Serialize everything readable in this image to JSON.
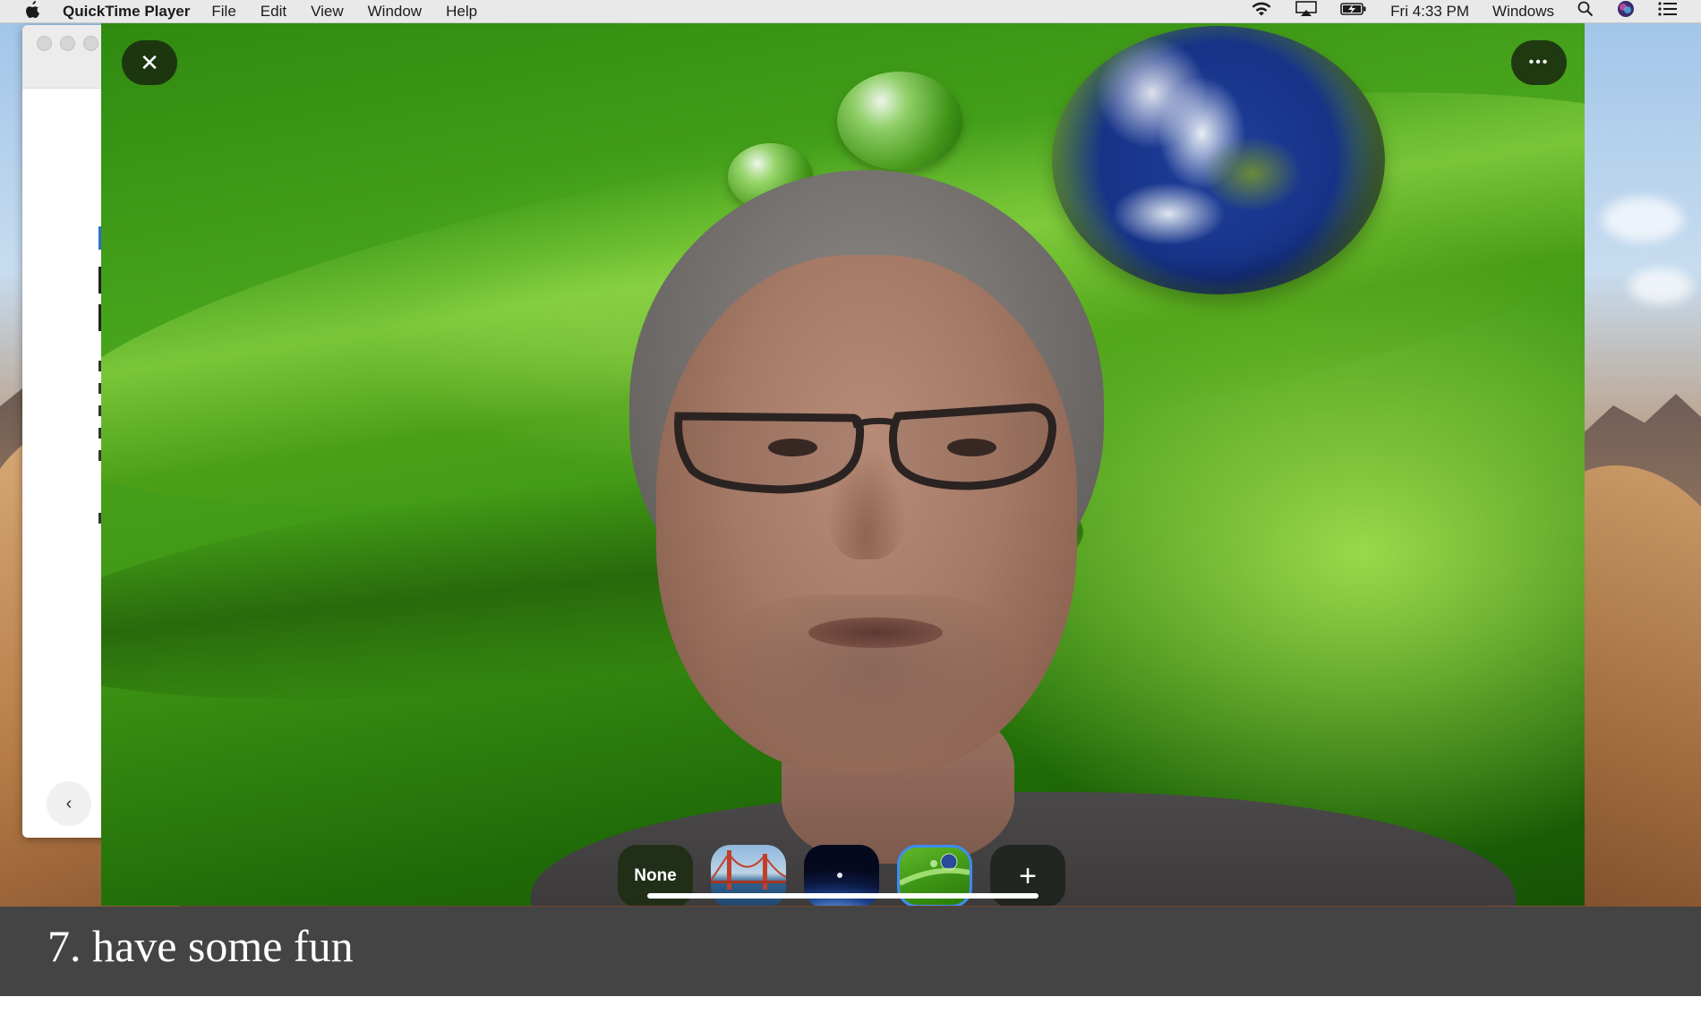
{
  "menubar": {
    "app_name": "QuickTime Player",
    "menus": [
      "File",
      "Edit",
      "View",
      "Window",
      "Help"
    ],
    "clock": "Fri 4:33 PM",
    "user_label": "Windows"
  },
  "video_controls": {
    "close_symbol": "✕",
    "more_symbol": "•••",
    "backgrounds": [
      {
        "label": "None",
        "kind": "none"
      },
      {
        "label": "",
        "kind": "golden-gate-bridge"
      },
      {
        "label": "",
        "kind": "earth-from-space"
      },
      {
        "label": "",
        "kind": "green-leaf-globe",
        "selected": true
      },
      {
        "label": "+",
        "kind": "add"
      }
    ]
  },
  "background_window": {
    "back_symbol": "‹"
  },
  "caption": {
    "text": "7. have some fun"
  },
  "colors": {
    "caption_bg": "#444444",
    "selected_outline": "#3e8cf5",
    "control_bg": "#19280f"
  }
}
